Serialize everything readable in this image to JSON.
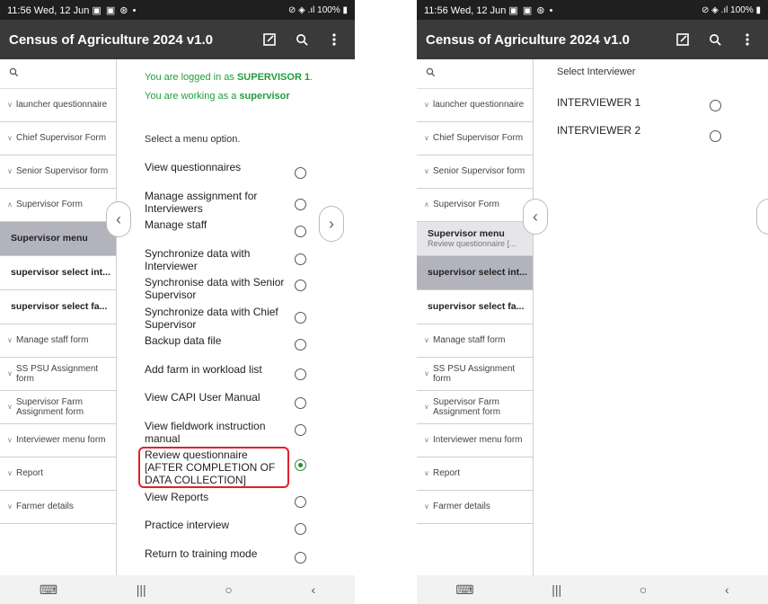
{
  "left": {
    "status": {
      "time": "11:56",
      "date": "Wed, 12 Jun",
      "icons": "▣ ▣ ⊛ •",
      "right": "⊘ ◈ .ıl 100% ▮"
    },
    "app_title": "Census of Agriculture 2024 v1.0",
    "sidebar": {
      "items": [
        {
          "label": "launcher questionnaire"
        },
        {
          "label": "Chief Supervisor Form"
        },
        {
          "label": "Senior Supervisor form"
        },
        {
          "label": "Supervisor Form"
        },
        {
          "label": "Supervisor menu"
        },
        {
          "label": "supervisor select int..."
        },
        {
          "label": "supervisor select fa..."
        },
        {
          "label": "Manage staff form"
        },
        {
          "label": "SS PSU Assignment form"
        },
        {
          "label": "Supervisor Farm Assignment form"
        },
        {
          "label": "Interviewer menu form"
        },
        {
          "label": "Report"
        },
        {
          "label": "Farmer details"
        }
      ]
    },
    "login_prefix": "You are logged in as ",
    "login_user": "SUPERVISOR 1",
    "login_suffix": ".",
    "working_prefix": "You are working as a ",
    "working_role": "supervisor",
    "prompt": "Select a menu option.",
    "options": [
      "View questionnaires",
      "Manage assignment for Interviewers",
      "Manage staff",
      "Synchronize data with Interviewer",
      "Synchronise data with Senior Supervisor",
      "Synchronize data with Chief Supervisor",
      "Backup data file",
      "Add farm in workload list",
      "View CAPI User Manual",
      "View fieldwork instruction manual",
      "Review questionnaire [AFTER COMPLETION OF DATA COLLECTION]",
      "View Reports",
      "Practice interview",
      "Return to training mode"
    ],
    "selected_index": 10
  },
  "right": {
    "status": {
      "time": "11:56",
      "date": "Wed, 12 Jun",
      "icons": "▣ ▣ ⊛ •",
      "right": "⊘ ◈ .ıl 100% ▮"
    },
    "app_title": "Census of Agriculture 2024 v1.0",
    "sidebar": {
      "items": [
        {
          "label": "launcher questionnaire"
        },
        {
          "label": "Chief Supervisor Form"
        },
        {
          "label": "Senior Supervisor form"
        },
        {
          "label": "Supervisor Form"
        },
        {
          "label": "Supervisor menu",
          "sub": "Review questionnaire [..."
        },
        {
          "label": "supervisor select int..."
        },
        {
          "label": "supervisor select fa..."
        },
        {
          "label": "Manage staff form"
        },
        {
          "label": "SS PSU Assignment form"
        },
        {
          "label": "Supervisor Farm Assignment form"
        },
        {
          "label": "Interviewer menu form"
        },
        {
          "label": "Report"
        },
        {
          "label": "Farmer details"
        }
      ]
    },
    "prompt": "Select Interviewer",
    "options": [
      "INTERVIEWER 1",
      "INTERVIEWER 2"
    ]
  }
}
